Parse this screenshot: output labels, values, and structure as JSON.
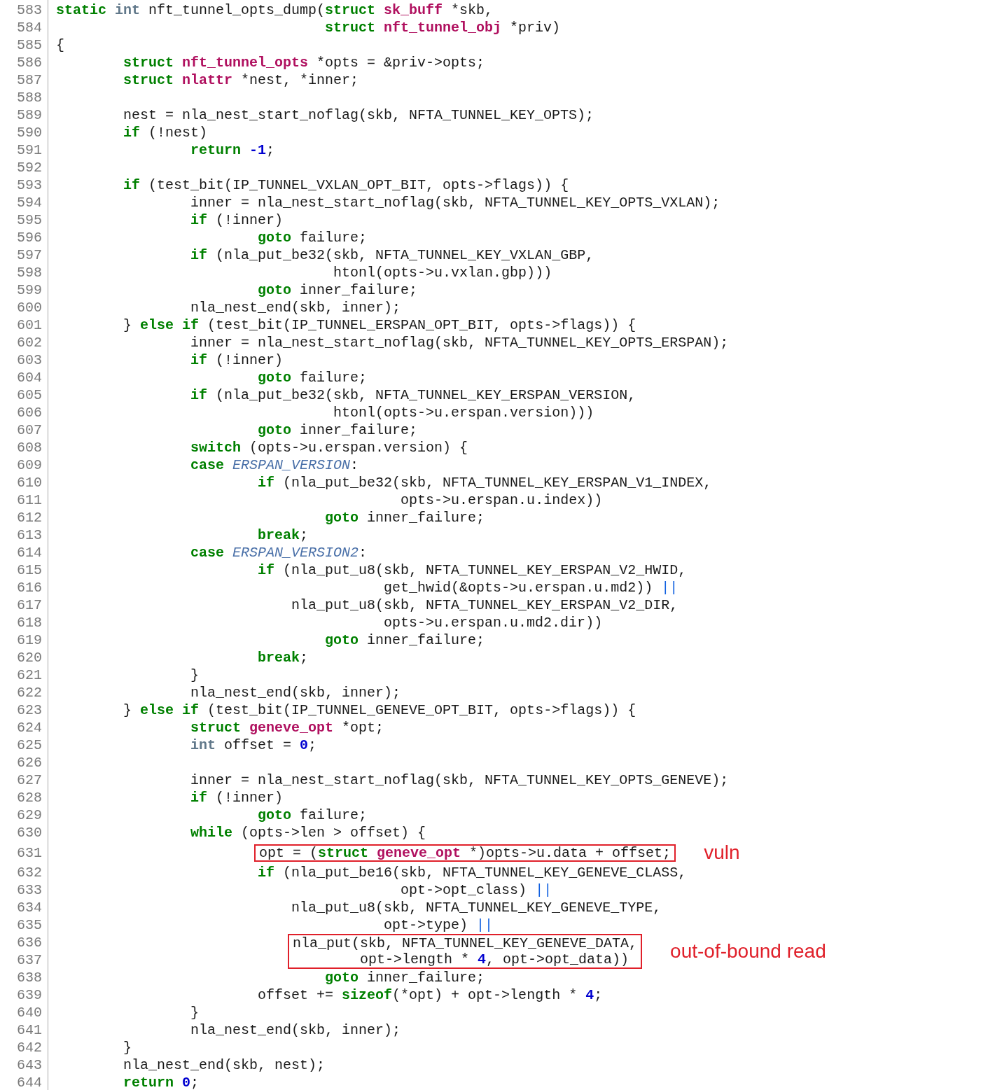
{
  "code_listing": {
    "lines": [
      {
        "number": "583",
        "tokens": [
          {
            "kind": "keyword",
            "text": "static "
          },
          {
            "kind": "primitive",
            "text": "int"
          },
          {
            "kind": "plain",
            "text": " nft_tunnel_opts_dump("
          },
          {
            "kind": "keyword",
            "text": "struct "
          },
          {
            "kind": "type",
            "text": "sk_buff"
          },
          {
            "kind": "plain",
            "text": " *skb,"
          }
        ]
      },
      {
        "number": "584",
        "tokens": [
          {
            "kind": "keyword",
            "text": "\t\t\t\tstruct "
          },
          {
            "kind": "type",
            "text": "nft_tunnel_obj"
          },
          {
            "kind": "plain",
            "text": " *priv)"
          }
        ]
      },
      {
        "number": "585",
        "tokens": [
          {
            "kind": "plain",
            "text": "{"
          }
        ]
      },
      {
        "number": "586",
        "tokens": [
          {
            "kind": "keyword",
            "text": "\tstruct "
          },
          {
            "kind": "type",
            "text": "nft_tunnel_opts"
          },
          {
            "kind": "plain",
            "text": " *opts = &priv->opts;"
          }
        ]
      },
      {
        "number": "587",
        "tokens": [
          {
            "kind": "keyword",
            "text": "\tstruct "
          },
          {
            "kind": "type",
            "text": "nlattr"
          },
          {
            "kind": "plain",
            "text": " *nest, *inner;"
          }
        ]
      },
      {
        "number": "588"
      },
      {
        "number": "589",
        "tokens": [
          {
            "kind": "plain",
            "text": "\tnest = nla_nest_start_noflag(skb, NFTA_TUNNEL_KEY_OPTS);"
          }
        ]
      },
      {
        "number": "590",
        "tokens": [
          {
            "kind": "keyword",
            "text": "\tif"
          },
          {
            "kind": "plain",
            "text": " (!nest)"
          }
        ]
      },
      {
        "number": "591",
        "tokens": [
          {
            "kind": "keyword",
            "text": "\t\treturn "
          },
          {
            "kind": "number",
            "text": "-1"
          },
          {
            "kind": "plain",
            "text": ";"
          }
        ]
      },
      {
        "number": "592"
      },
      {
        "number": "593",
        "tokens": [
          {
            "kind": "keyword",
            "text": "\tif"
          },
          {
            "kind": "plain",
            "text": " (test_bit(IP_TUNNEL_VXLAN_OPT_BIT, opts->flags)) {"
          }
        ]
      },
      {
        "number": "594",
        "tokens": [
          {
            "kind": "plain",
            "text": "\t\tinner = nla_nest_start_noflag(skb, NFTA_TUNNEL_KEY_OPTS_VXLAN);"
          }
        ]
      },
      {
        "number": "595",
        "tokens": [
          {
            "kind": "keyword",
            "text": "\t\tif"
          },
          {
            "kind": "plain",
            "text": " (!inner)"
          }
        ]
      },
      {
        "number": "596",
        "tokens": [
          {
            "kind": "keyword",
            "text": "\t\t\tgoto"
          },
          {
            "kind": "plain",
            "text": " failure;"
          }
        ]
      },
      {
        "number": "597",
        "tokens": [
          {
            "kind": "keyword",
            "text": "\t\tif"
          },
          {
            "kind": "plain",
            "text": " (nla_put_be32(skb, NFTA_TUNNEL_KEY_VXLAN_GBP,"
          }
        ]
      },
      {
        "number": "598",
        "tokens": [
          {
            "kind": "plain",
            "text": "\t\t\t\t htonl(opts->u.vxlan.gbp)))"
          }
        ]
      },
      {
        "number": "599",
        "tokens": [
          {
            "kind": "keyword",
            "text": "\t\t\tgoto"
          },
          {
            "kind": "plain",
            "text": " inner_failure;"
          }
        ]
      },
      {
        "number": "600",
        "tokens": [
          {
            "kind": "plain",
            "text": "\t\tnla_nest_end(skb, inner);"
          }
        ]
      },
      {
        "number": "601",
        "tokens": [
          {
            "kind": "plain",
            "text": "\t} "
          },
          {
            "kind": "keyword",
            "text": "else if"
          },
          {
            "kind": "plain",
            "text": " (test_bit(IP_TUNNEL_ERSPAN_OPT_BIT, opts->flags)) {"
          }
        ]
      },
      {
        "number": "602",
        "tokens": [
          {
            "kind": "plain",
            "text": "\t\tinner = nla_nest_start_noflag(skb, NFTA_TUNNEL_KEY_OPTS_ERSPAN);"
          }
        ]
      },
      {
        "number": "603",
        "tokens": [
          {
            "kind": "keyword",
            "text": "\t\tif"
          },
          {
            "kind": "plain",
            "text": " (!inner)"
          }
        ]
      },
      {
        "number": "604",
        "tokens": [
          {
            "kind": "keyword",
            "text": "\t\t\tgoto"
          },
          {
            "kind": "plain",
            "text": " failure;"
          }
        ]
      },
      {
        "number": "605",
        "tokens": [
          {
            "kind": "keyword",
            "text": "\t\tif"
          },
          {
            "kind": "plain",
            "text": " (nla_put_be32(skb, NFTA_TUNNEL_KEY_ERSPAN_VERSION,"
          }
        ]
      },
      {
        "number": "606",
        "tokens": [
          {
            "kind": "plain",
            "text": "\t\t\t\t htonl(opts->u.erspan.version)))"
          }
        ]
      },
      {
        "number": "607",
        "tokens": [
          {
            "kind": "keyword",
            "text": "\t\t\tgoto"
          },
          {
            "kind": "plain",
            "text": " inner_failure;"
          }
        ]
      },
      {
        "number": "608",
        "tokens": [
          {
            "kind": "keyword",
            "text": "\t\tswitch"
          },
          {
            "kind": "plain",
            "text": " (opts->u.erspan.version) {"
          }
        ]
      },
      {
        "number": "609",
        "tokens": [
          {
            "kind": "keyword",
            "text": "\t\tcase "
          },
          {
            "kind": "constant",
            "text": "ERSPAN_VERSION"
          },
          {
            "kind": "plain",
            "text": ":"
          }
        ]
      },
      {
        "number": "610",
        "tokens": [
          {
            "kind": "keyword",
            "text": "\t\t\tif"
          },
          {
            "kind": "plain",
            "text": " (nla_put_be32(skb, NFTA_TUNNEL_KEY_ERSPAN_V1_INDEX,"
          }
        ]
      },
      {
        "number": "611",
        "tokens": [
          {
            "kind": "plain",
            "text": "\t\t\t\t\t opts->u.erspan.u.index))"
          }
        ]
      },
      {
        "number": "612",
        "tokens": [
          {
            "kind": "keyword",
            "text": "\t\t\t\tgoto"
          },
          {
            "kind": "plain",
            "text": " inner_failure;"
          }
        ]
      },
      {
        "number": "613",
        "tokens": [
          {
            "kind": "keyword",
            "text": "\t\t\tbreak"
          },
          {
            "kind": "plain",
            "text": ";"
          }
        ]
      },
      {
        "number": "614",
        "tokens": [
          {
            "kind": "keyword",
            "text": "\t\tcase "
          },
          {
            "kind": "constant",
            "text": "ERSPAN_VERSION2"
          },
          {
            "kind": "plain",
            "text": ":"
          }
        ]
      },
      {
        "number": "615",
        "tokens": [
          {
            "kind": "keyword",
            "text": "\t\t\tif"
          },
          {
            "kind": "plain",
            "text": " (nla_put_u8(skb, NFTA_TUNNEL_KEY_ERSPAN_V2_HWID,"
          }
        ]
      },
      {
        "number": "616",
        "tokens": [
          {
            "kind": "plain",
            "text": "\t\t\t\t       get_hwid(&opts->u.erspan.u.md2)) "
          },
          {
            "kind": "operator",
            "text": "||"
          }
        ]
      },
      {
        "number": "617",
        "tokens": [
          {
            "kind": "plain",
            "text": "\t\t\t    nla_put_u8(skb, NFTA_TUNNEL_KEY_ERSPAN_V2_DIR,"
          }
        ]
      },
      {
        "number": "618",
        "tokens": [
          {
            "kind": "plain",
            "text": "\t\t\t\t       opts->u.erspan.u.md2.dir))"
          }
        ]
      },
      {
        "number": "619",
        "tokens": [
          {
            "kind": "keyword",
            "text": "\t\t\t\tgoto"
          },
          {
            "kind": "plain",
            "text": " inner_failure;"
          }
        ]
      },
      {
        "number": "620",
        "tokens": [
          {
            "kind": "keyword",
            "text": "\t\t\tbreak"
          },
          {
            "kind": "plain",
            "text": ";"
          }
        ]
      },
      {
        "number": "621",
        "tokens": [
          {
            "kind": "plain",
            "text": "\t\t}"
          }
        ]
      },
      {
        "number": "622",
        "tokens": [
          {
            "kind": "plain",
            "text": "\t\tnla_nest_end(skb, inner);"
          }
        ]
      },
      {
        "number": "623",
        "tokens": [
          {
            "kind": "plain",
            "text": "\t} "
          },
          {
            "kind": "keyword",
            "text": "else if"
          },
          {
            "kind": "plain",
            "text": " (test_bit(IP_TUNNEL_GENEVE_OPT_BIT, opts->flags)) {"
          }
        ]
      },
      {
        "number": "624",
        "tokens": [
          {
            "kind": "keyword",
            "text": "\t\tstruct "
          },
          {
            "kind": "type",
            "text": "geneve_opt"
          },
          {
            "kind": "plain",
            "text": " *opt;"
          }
        ]
      },
      {
        "number": "625",
        "tokens": [
          {
            "kind": "primitive",
            "text": "\t\tint"
          },
          {
            "kind": "plain",
            "text": " offset = "
          },
          {
            "kind": "number",
            "text": "0"
          },
          {
            "kind": "plain",
            "text": ";"
          }
        ]
      },
      {
        "number": "626"
      },
      {
        "number": "627",
        "tokens": [
          {
            "kind": "plain",
            "text": "\t\tinner = nla_nest_start_noflag(skb, NFTA_TUNNEL_KEY_OPTS_GENEVE);"
          }
        ]
      },
      {
        "number": "628",
        "tokens": [
          {
            "kind": "keyword",
            "text": "\t\tif"
          },
          {
            "kind": "plain",
            "text": " (!inner)"
          }
        ]
      },
      {
        "number": "629",
        "tokens": [
          {
            "kind": "keyword",
            "text": "\t\t\tgoto"
          },
          {
            "kind": "plain",
            "text": " failure;"
          }
        ]
      },
      {
        "number": "630",
        "tokens": [
          {
            "kind": "keyword",
            "text": "\t\twhile"
          },
          {
            "kind": "plain",
            "text": " (opts->len > offset) {"
          }
        ]
      },
      {
        "kind": "annotated",
        "label": "vuln",
        "lines": [
          {
            "number": "631",
            "tokens": [
              {
                "kind": "plain",
                "text": "\t\t\topt = ("
              },
              {
                "kind": "keyword",
                "text": "struct "
              },
              {
                "kind": "type",
                "text": "geneve_opt"
              },
              {
                "kind": "plain",
                "text": " *)opts->u.data + offset;"
              }
            ]
          }
        ]
      },
      {
        "number": "632",
        "tokens": [
          {
            "kind": "keyword",
            "text": "\t\t\tif"
          },
          {
            "kind": "plain",
            "text": " (nla_put_be16(skb, NFTA_TUNNEL_KEY_GENEVE_CLASS,"
          }
        ]
      },
      {
        "number": "633",
        "tokens": [
          {
            "kind": "plain",
            "text": "\t\t\t\t\t opt->opt_class) "
          },
          {
            "kind": "operator",
            "text": "||"
          }
        ]
      },
      {
        "number": "634",
        "tokens": [
          {
            "kind": "plain",
            "text": "\t\t\t    nla_put_u8(skb, NFTA_TUNNEL_KEY_GENEVE_TYPE,"
          }
        ]
      },
      {
        "number": "635",
        "tokens": [
          {
            "kind": "plain",
            "text": "\t\t\t\t       opt->type) "
          },
          {
            "kind": "operator",
            "text": "||"
          }
        ]
      },
      {
        "kind": "annotated",
        "label": "out-of-bound read",
        "lines": [
          {
            "number": "636",
            "tokens": [
              {
                "kind": "plain",
                "text": "\t\t\t    nla_put(skb, NFTA_TUNNEL_KEY_GENEVE_DATA,"
              }
            ]
          },
          {
            "number": "637",
            "tokens": [
              {
                "kind": "plain",
                "text": "\t\t\t\t    opt->length * "
              },
              {
                "kind": "number",
                "text": "4"
              },
              {
                "kind": "plain",
                "text": ", opt->opt_data))"
              }
            ]
          }
        ]
      },
      {
        "number": "638",
        "tokens": [
          {
            "kind": "keyword",
            "text": "\t\t\t\tgoto"
          },
          {
            "kind": "plain",
            "text": " inner_failure;"
          }
        ]
      },
      {
        "number": "639",
        "tokens": [
          {
            "kind": "plain",
            "text": "\t\t\toffset += "
          },
          {
            "kind": "keyword",
            "text": "sizeof"
          },
          {
            "kind": "plain",
            "text": "(*opt) + opt->length * "
          },
          {
            "kind": "number",
            "text": "4"
          },
          {
            "kind": "plain",
            "text": ";"
          }
        ]
      },
      {
        "number": "640",
        "tokens": [
          {
            "kind": "plain",
            "text": "\t\t}"
          }
        ]
      },
      {
        "number": "641",
        "tokens": [
          {
            "kind": "plain",
            "text": "\t\tnla_nest_end(skb, inner);"
          }
        ]
      },
      {
        "number": "642",
        "tokens": [
          {
            "kind": "plain",
            "text": "\t}"
          }
        ]
      },
      {
        "number": "643",
        "tokens": [
          {
            "kind": "plain",
            "text": "\tnla_nest_end(skb, nest);"
          }
        ]
      },
      {
        "number": "644",
        "tokens": [
          {
            "kind": "keyword",
            "text": "\treturn "
          },
          {
            "kind": "number",
            "text": "0"
          },
          {
            "kind": "plain",
            "text": ";"
          }
        ]
      }
    ]
  }
}
